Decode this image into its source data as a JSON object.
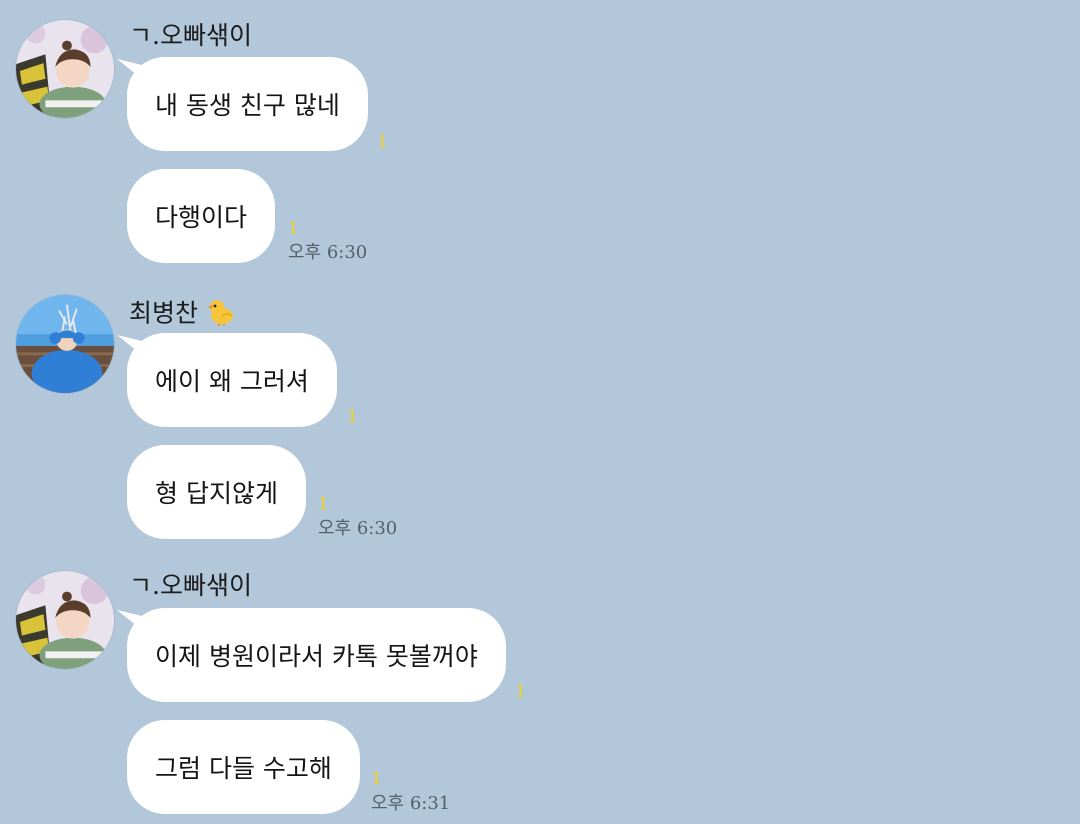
{
  "conversation": {
    "groups": [
      {
        "sender": "ㄱ.오빠샊이",
        "messages": [
          {
            "text": "내 동생 친구 많네",
            "unread": "1"
          },
          {
            "text": "다행이다",
            "unread": "1",
            "time": "오후 6:30"
          }
        ]
      },
      {
        "sender": "최병찬",
        "sender_icon": "chick-emoji",
        "messages": [
          {
            "text": "에이 왜 그러셔",
            "unread": "1"
          },
          {
            "text": "형 답지않게",
            "unread": "1",
            "time": "오후 6:30"
          }
        ]
      },
      {
        "sender": "ㄱ.오빠샊이",
        "messages": [
          {
            "text": "이제 병원이라서 카톡 못볼꺼야",
            "unread": "1"
          },
          {
            "text": "그럼 다들 수고해",
            "unread": "1",
            "time": "오후 6:31"
          }
        ]
      }
    ]
  },
  "colors": {
    "chat_background": "#b2c7da",
    "bubble": "#ffffff",
    "unread_count": "#f2d21a",
    "timestamp": "#55606b"
  }
}
